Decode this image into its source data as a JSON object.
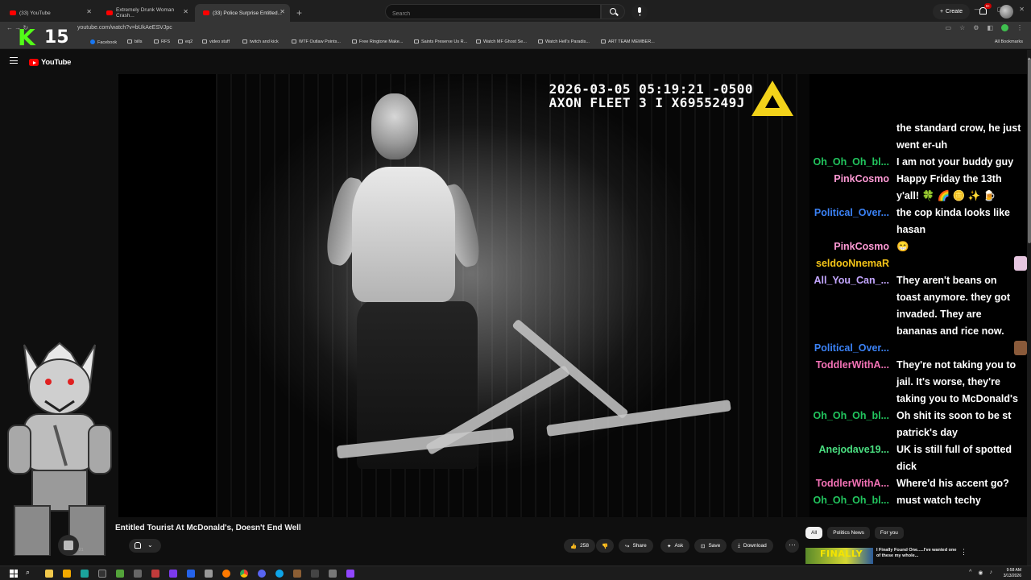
{
  "browser": {
    "tabs": [
      {
        "label": "(33) YouTube"
      },
      {
        "label": "Extremely Drunk Woman Crash..."
      },
      {
        "label": "(33) Police Surprise Entitled..."
      }
    ],
    "url": "youtube.com/watch?v=bUkAeESVJpc",
    "bookmarks": [
      "Facebook",
      "bills",
      "RFS",
      "eq2",
      "video stuff",
      "twitch and kick",
      "WTF Outlaw Points...",
      "Free Ringtone Make...",
      "Saints Preserve Us R...",
      "Watch MF Ghost Se...",
      "Watch Hell's Paradis...",
      "ART TEAM MEMBER..."
    ],
    "all_bookmarks": "All Bookmarks"
  },
  "overlay": {
    "kick_letter": "K",
    "kick_count": "15"
  },
  "youtube": {
    "logo_text": "YouTube",
    "search_placeholder": "Search",
    "create_label": "Create",
    "notif_badge": "9+"
  },
  "video": {
    "timestamp_line1": "2026-03-05 05:19:21 -0500",
    "timestamp_line2": "AXON FLEET 3 I X6955249J",
    "title": "Entitled Tourist At McDonald's, Doesn't End Well",
    "channel_sub": "21",
    "like_count": "258",
    "share_label": "Share",
    "ask_label": "Ask",
    "save_label": "Save",
    "download_label": "Download"
  },
  "chat": [
    {
      "name": "",
      "color": "#ffffff",
      "text": "the standard crow, he just went er-uh"
    },
    {
      "name": "Oh_Oh_Oh_bl...",
      "color": "#22c55e",
      "text": "I am not your buddy guy"
    },
    {
      "name": "PinkCosmo",
      "color": "#ff9ad5",
      "text": "Happy Friday the 13th y'all! 🍀 🌈 🪙 ✨ 🍺"
    },
    {
      "name": "Political_Over...",
      "color": "#3b82f6",
      "text": "the cop kinda looks like hasan"
    },
    {
      "name": "PinkCosmo",
      "color": "#ff9ad5",
      "text": "😁"
    },
    {
      "name": "seldooNnemaR",
      "color": "#f5c518",
      "text": ""
    },
    {
      "name": "All_You_Can_...",
      "color": "#c4a7ff",
      "text": "They aren't beans on toast anymore. they got invaded. They are bananas and rice now."
    },
    {
      "name": "Political_Over...",
      "color": "#3b82f6",
      "text": ""
    },
    {
      "name": "ToddlerWithA...",
      "color": "#f472b6",
      "text": "They're not taking you to jail. It's worse, they're taking you to McDonald's"
    },
    {
      "name": "Oh_Oh_Oh_bl...",
      "color": "#22c55e",
      "text": "Oh shit its soon to be st patrick's day"
    },
    {
      "name": "Anejodave19...",
      "color": "#4ade80",
      "text": "UK is still full of spotted dick"
    },
    {
      "name": "ToddlerWithA...",
      "color": "#f472b6",
      "text": "Where'd his accent go?"
    },
    {
      "name": "Oh_Oh_Oh_bl...",
      "color": "#22c55e",
      "text": "must watch techy"
    }
  ],
  "recommend": {
    "chips": [
      "All",
      "Politics News",
      "For you"
    ],
    "thumb_text": "FINALLY",
    "title": "I Finally Found One.....I've wanted one of these my whole..."
  },
  "taskbar": {
    "time": "9:58 AM",
    "date": "3/13/2026"
  }
}
